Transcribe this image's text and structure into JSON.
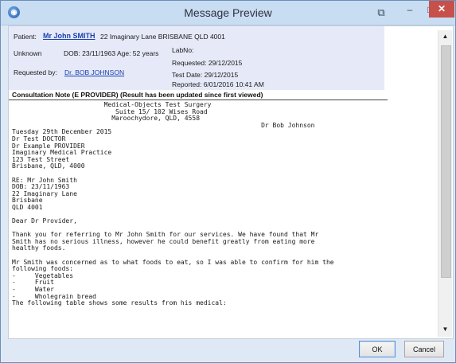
{
  "window": {
    "title": "Message Preview"
  },
  "header": {
    "patient_label": "Patient:",
    "patient_name": "Mr John SMITH",
    "patient_address": "22 Imaginary Lane BRISBANE QLD 4001",
    "sex": "Unknown",
    "dob_age": "DOB: 23/11/1963 Age: 52 years",
    "requested_by_label": "Requested by:",
    "requested_by": "Dr. BOB JOHNSON",
    "lab_no": "LabNo:",
    "requested": "Requested: 29/12/2015",
    "test_date": "Test Date:  29/12/2015",
    "reported": "Reported:  6/01/2016 10:41 AM"
  },
  "note": {
    "heading": "Consultation Note (E PROVIDER) (Result has been updated since first viewed)",
    "body": "                        Medical-Objects Test Surgery\n                           Suite 15/ 102 Wises Road\n                          Maroochydore, QLD, 4558\n                                                                 Dr Bob Johnson\nTuesday 29th December 2015\nDr Test DOCTOR\nDr Example PROVIDER\nImaginary Medical Practice\n123 Test Street\nBrisbane, QLD, 4000\n\nRE: Mr John Smith\nDOB: 23/11/1963\n22 Imaginary Lane\nBrisbane\nQLD 4001\n\nDear Dr Provider,\n\nThank you for referring to Mr John Smith for our services. We have found that Mr\nSmith has no serious illness, however he could benefit greatly from eating more\nhealthy foods.\n\nMr Smith was concerned as to what foods to eat, so I was able to confirm for him the\nfollowing foods:\n-     Vegetables\n-     Fruit\n-     Water\n-     Wholegrain bread\nThe following table shows some results from his medical:"
  },
  "scrollbar": {
    "up": "▲",
    "down": "▼"
  },
  "buttons": {
    "ok": "OK",
    "cancel": "Cancel"
  },
  "icons": {
    "app": "message-app-icon",
    "restore": "restore-icon",
    "minimize": "minimize-icon",
    "maximize": "maximize-icon",
    "close": "close-icon"
  },
  "colors": {
    "close": "#c7504a",
    "link": "#1a3fb0",
    "header_panel": "#e6eaf8"
  }
}
